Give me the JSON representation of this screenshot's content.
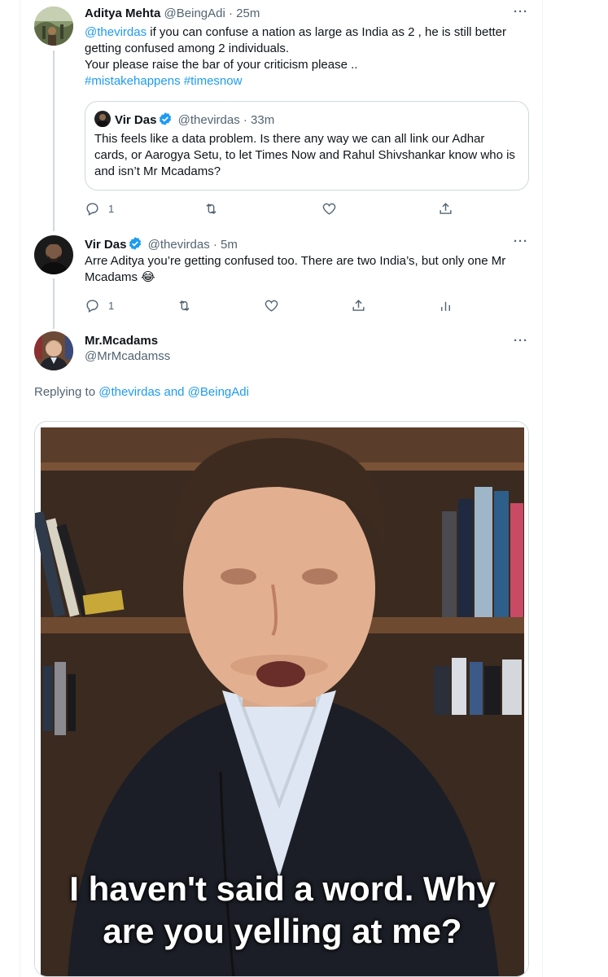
{
  "tweets": [
    {
      "name": "Aditya Mehta",
      "handle": "@BeingAdi",
      "time": "25m",
      "mention": "@thevirdas",
      "text1": " if you can confuse a nation as large as India as 2 , he is still better",
      "text2": "getting confused among 2 individuals.",
      "text3": "Your please raise the bar of your criticism please ..",
      "hashtags": "#mistakehappens #timesnow",
      "reply_count": "1"
    },
    {
      "name": "Vir Das",
      "handle": "@thevirdas",
      "time": "5m",
      "text1": "Arre Aditya you’re getting confused too. There are two India’s, but only one Mr",
      "text2": "Mcadams 😂",
      "reply_count": "1"
    },
    {
      "name": "Mr.Mcadams",
      "handle": "@MrMcadamss"
    }
  ],
  "quote": {
    "name": "Vir Das",
    "handle": "@thevirdas",
    "time": "33m",
    "line1": "This feels like a data problem. Is there any way we can all link our Adhar",
    "line2": "cards, or Aarogya Setu, to let Times Now and Rahul Shivshankar know who is",
    "line3": "and isn’t Mr Mcadams?"
  },
  "replying": {
    "prefix": "Replying to ",
    "users": "@thevirdas and @BeingAdi"
  },
  "media": {
    "caption1": "I haven't said a word. Why",
    "caption2": "are you yelling at me?"
  },
  "ui": {
    "dot": " · ",
    "more": "···"
  },
  "colors": {
    "accent": "#1d9bf0",
    "muted": "#536471",
    "border": "#cfd9de"
  },
  "icons": [
    "reply-icon",
    "retweet-icon",
    "like-icon",
    "share-icon",
    "analytics-icon",
    "verified-icon",
    "more-icon"
  ]
}
